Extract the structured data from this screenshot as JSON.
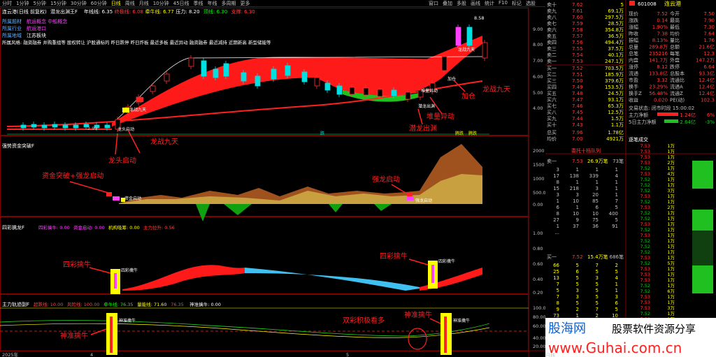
{
  "toolbar": {
    "periods": [
      "分时",
      "1分钟",
      "5分钟",
      "15分钟",
      "30分钟",
      "60分钟",
      "日线",
      "周线",
      "月线",
      "10分钟",
      "45日线",
      "季线",
      "年线",
      "多周期",
      "更多"
    ],
    "active": "日线",
    "right": [
      "窗口",
      "叠加",
      "多股",
      "画线",
      "统计",
      "F10",
      "标记",
      "选股"
    ]
  },
  "main": {
    "title": "连云港(日线 前复权)",
    "indicator": "潜龙出渊王F",
    "legend": [
      {
        "t": "年线线: 6.35",
        "c": "#ffffff"
      },
      {
        "t": "终极线: 6.08",
        "c": "#ff4040"
      },
      {
        "t": "牵牛线: 6.77",
        "c": "#ffff00"
      },
      {
        "t": "压力: 8.20",
        "c": "#ffffff"
      },
      {
        "t": "顶线: 6.30",
        "c": "#00ff00"
      },
      {
        "t": "支撑: 6.30",
        "c": "#ff4040"
      }
    ],
    "topic1": "所属题材",
    "topic1v": "航运概念 中船概念",
    "topic2": "所属行业",
    "topic2v": "航运港口",
    "topic3": "所属地域",
    "topic3v": "江苏板块",
    "news": "所属风格: 融资融券 并购重组等 股权转让 沪股通标的 昨日跌停 昨日炸板 最近多板 最近异动 融资融券 最近减持 近期新高 新型储能等",
    "yticks": [
      "9.00",
      "8.00",
      "7.00",
      "6.00",
      "5.00",
      "4.00"
    ],
    "tags": [
      "龙战九天",
      "龙头启动",
      "潜龙出渊",
      "堆量异动",
      "加仓",
      "龙战九天",
      "加仓",
      "堆量异动",
      "潜龙出渊",
      "龙战九天",
      "8.58",
      "2.99"
    ],
    "chips": [
      "庄",
      "减",
      "跌",
      "腾跌"
    ]
  },
  "p2": {
    "title": "强势资金突破F",
    "yticks": [
      "2000",
      "1500",
      "1000",
      "500.0",
      "0.00"
    ],
    "labels": [
      "资金突破+强龙启动",
      "强龙启动",
      "资金启动",
      "强龙启动"
    ]
  },
  "p3": {
    "title": "四彩擒龙F",
    "legend": [
      {
        "t": "四彩擒牛: 0.00",
        "c": "#ff40ff"
      },
      {
        "t": "资金启动: 0.00",
        "c": "#ff40ff"
      },
      {
        "t": "机构吸筹: 0.00",
        "c": "#ffff00"
      },
      {
        "t": "主力拉升: 0.56",
        "c": "#ff4040"
      }
    ],
    "yticks": [
      "1.00",
      "0.80",
      "0.60",
      "0.40",
      "0.20"
    ],
    "labels": [
      "四彩擒牛",
      "四彩擒牛",
      "四彩擒牛",
      "四彩擒牛"
    ]
  },
  "p4": {
    "title": "主力轨迹副F",
    "legend": [
      {
        "t": "超跌线: 10.00",
        "c": "#ff4040"
      },
      {
        "t": "风险线: 100.00",
        "c": "#ff4040"
      },
      {
        "t": "牵牛线: 76.35",
        "c": "#00ff00"
      },
      {
        "t": "量能线: 71.60",
        "c": "#ffff00"
      },
      {
        "t": "76.35",
        "c": "#ff4040"
      },
      {
        "t": "神准擒牛: 0.00",
        "c": "#ffffff"
      }
    ],
    "yticks": [
      "100.0",
      "80.00",
      "60.00",
      "40.00",
      "20.00"
    ],
    "labels": [
      "神准擒牛",
      "双彩积极看多",
      "神准擒牛",
      "神准擒牛",
      "神准擒牛"
    ],
    "xaxis": [
      "2025年",
      "4",
      "5"
    ]
  },
  "panel": {
    "code": "601008",
    "name": "连云港",
    "asks": [
      [
        "卖十",
        "7.62",
        "5"
      ],
      [
        "卖九",
        "7.61",
        "69.1万"
      ],
      [
        "卖八",
        "7.60",
        "297.5万"
      ],
      [
        "卖七",
        "7.59",
        "28.5万"
      ],
      [
        "卖六",
        "7.58",
        "354.8万"
      ],
      [
        "卖五",
        "7.57",
        "36.5万"
      ],
      [
        "卖四",
        "7.56",
        "494.4万"
      ],
      [
        "卖三",
        "7.55",
        "37.5万"
      ],
      [
        "卖二",
        "7.54",
        "40.1万"
      ],
      [
        "卖一",
        "7.53",
        "247.1万"
      ]
    ],
    "bids": [
      [
        "买一",
        "7.52",
        "703.5万"
      ],
      [
        "买二",
        "7.51",
        "185.9万"
      ],
      [
        "买三",
        "7.50",
        "379.6万"
      ],
      [
        "买四",
        "7.49",
        "153.5万"
      ],
      [
        "买五",
        "7.48",
        "24.5万"
      ],
      [
        "买六",
        "7.47",
        "93.1万"
      ],
      [
        "买七",
        "7.46",
        "65.3万"
      ],
      [
        "买八",
        "7.45",
        "12.5万"
      ],
      [
        "买九",
        "7.44",
        "1.5万"
      ],
      [
        "买十",
        "7.43",
        "1.1万"
      ]
    ],
    "jj": [
      "总买",
      "7.96",
      "1.78亿"
    ],
    "jj2": [
      "均价",
      "7.00",
      "4921万"
    ],
    "stats": [
      [
        "现价",
        "7.52",
        "今开",
        "7.50"
      ],
      [
        "涨跌",
        "0.14",
        "最高",
        "7.90"
      ],
      [
        "涨幅",
        "1.90%",
        "最低",
        "7.30"
      ],
      [
        "昨收",
        "7.38",
        "均价",
        "7.64"
      ],
      [
        "振幅",
        "8.13%",
        "量比",
        "1.76"
      ],
      [
        "总量",
        "289.8万",
        "总额",
        "21.6亿"
      ],
      [
        "总笔",
        "235216",
        "每笔",
        "12.3"
      ],
      [
        "内盘",
        "141.7万",
        "外盘",
        "147.2万"
      ],
      [
        "涨停",
        "8.12",
        "跌停",
        "6.64"
      ],
      [
        "流通",
        "133.8亿",
        "总股本",
        "93.3亿"
      ],
      [
        "市盈",
        "3.32",
        "流通比",
        "12.4亿"
      ],
      [
        "换手",
        "23.29%",
        "流通A",
        "12.4亿"
      ],
      [
        "换手Z",
        "56.48%",
        "流通Z",
        "12.4亿"
      ],
      [
        "收益",
        "0.020",
        "PE(动)",
        "102.3"
      ]
    ],
    "status": "交易状态: 闭市时段 15:00:02",
    "flow1": [
      "主力净额",
      "1.24亿",
      "6%"
    ],
    "flow2": [
      "5日主力净额",
      "-2.64亿",
      "-3%"
    ],
    "ticksTitle": "逐笔成交",
    "ticks": [
      "7.53",
      "7.53",
      "7.53",
      "7.53",
      "7.52",
      "7.53",
      "7.52",
      "7.52",
      "7.52",
      "7.53",
      "7.52",
      "7.53",
      "7.52",
      "7.52",
      "7.53",
      "7.52",
      "7.53",
      "7.52",
      "7.52",
      "7.52",
      "7.53",
      "7.52",
      "7.53",
      "7.53",
      "7.53",
      "7.52",
      "7.52",
      "7.53",
      "7.53",
      "7.53",
      "7.52",
      "7.53",
      "7.52",
      "7.53",
      "7.53",
      "7.53"
    ],
    "tickVols": [
      "1万",
      "1万",
      "1万",
      "2万",
      "1万",
      "4万",
      "1万",
      "1万",
      "3万",
      "1万",
      "1万",
      "2万",
      "1万",
      "1万",
      "1万",
      "1万",
      "1万",
      "1万",
      "1万",
      "1万",
      "1万",
      "5万",
      "1万",
      "1万",
      "1万",
      "1万",
      "6万",
      "1万",
      "1万",
      "3万",
      "1万",
      "1万",
      "1万",
      "1万",
      "1万",
      "1万"
    ],
    "qdTitle": "委托十档队列",
    "qd1": [
      "卖一",
      "7.53",
      "26.9万笔",
      "73笔"
    ],
    "qd2": [
      "买一",
      "7.52",
      "15.4万笔",
      "686笔"
    ],
    "qdRows": [
      [
        "3",
        "1",
        "1",
        "1"
      ],
      [
        "17",
        "138",
        "339",
        "4"
      ],
      [
        "8",
        "1",
        "1",
        "1"
      ],
      [
        "15",
        "218",
        "3",
        "1"
      ],
      [
        "3",
        "3",
        "20",
        "1"
      ],
      [
        "1",
        "10",
        "85",
        "7"
      ],
      [
        "6",
        "1",
        "6",
        "5"
      ],
      [
        "8",
        "10",
        "10",
        "400"
      ],
      [
        "27",
        "9",
        "75",
        "5"
      ],
      [
        "1",
        "37",
        "36",
        "91"
      ]
    ],
    "qdRows2": [
      [
        "66",
        "5",
        "7",
        "2"
      ],
      [
        "25",
        "6",
        "5",
        "5"
      ],
      [
        "13",
        "5",
        "3",
        "4"
      ],
      [
        "7",
        "5",
        "5",
        "1"
      ],
      [
        "5",
        "3",
        "5",
        "1"
      ],
      [
        "7",
        "3",
        "5",
        "3"
      ],
      [
        "8",
        "5",
        "5",
        "6"
      ],
      [
        "9",
        "2",
        "7",
        "5"
      ],
      [
        "73",
        "1",
        "2",
        "10"
      ],
      [
        "3",
        "10",
        "9",
        "1"
      ]
    ],
    "wm1": "股海网",
    "wm2": "股票软件资源分享",
    "wm3": "www.Guhai.com.cn",
    "bottomFoot": [
      "日线"
    ]
  },
  "colors": {
    "up": "#ff3c3c",
    "down": "#00e0e0",
    "grid": "#800000",
    "axis": "#b00000"
  }
}
